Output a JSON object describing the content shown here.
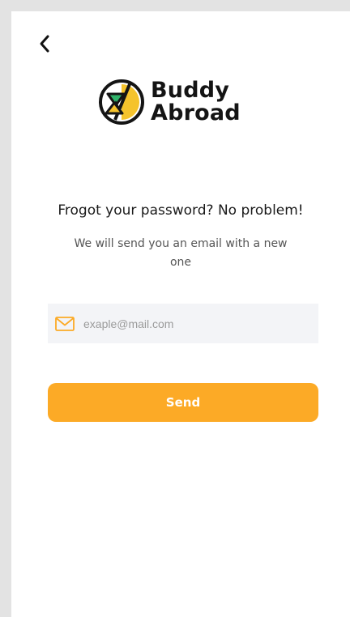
{
  "app": {
    "brand_line1": "Buddy",
    "brand_line2": "Abroad"
  },
  "colors": {
    "accent": "#fcaa26",
    "field_background": "#f3f4f7",
    "logo_green": "#2fb36a",
    "logo_yellow": "#f5c32c"
  },
  "icons": {
    "back": "chevron-left-icon",
    "email": "envelope-icon",
    "logo": "buddy-abroad-logo"
  },
  "content": {
    "heading": "Frogot your password? No problem!",
    "subtext": "We will send you an email with a new one"
  },
  "form": {
    "email_value": "",
    "email_placeholder": "exaple@mail.com",
    "send_label": "Send"
  }
}
